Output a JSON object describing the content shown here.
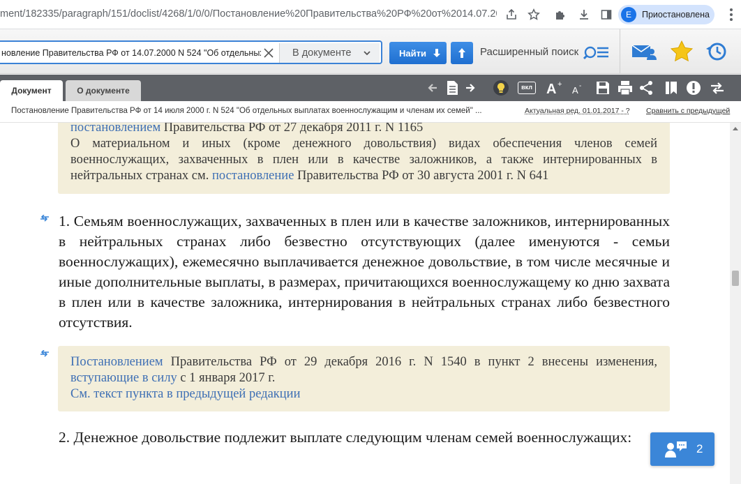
{
  "browser": {
    "url": "ment/182335/paragraph/151/doclist/4268/1/0/0/Постановление%20Правительства%20РФ%20от%2014.07.2000...",
    "profile_initial": "E",
    "profile_status": "Приостановлена"
  },
  "search": {
    "query": "новление Правительства РФ от 14.07.2000 N 524 \"Об отдельных вы",
    "scope": "В документе",
    "find_label": "Найти",
    "advanced_label": "Расширенный поиск"
  },
  "tabs": {
    "document": "Документ",
    "about": "О документе"
  },
  "doc_toolbar": {
    "toggle_label": "вкл"
  },
  "doc_line": {
    "title": "Постановление Правительства РФ от 14 июля 2000 г. N 524 \"Об отдельных выплатах военнослужащим и членам их семей\" ...",
    "edition": "Актуальная ред. 01.01.2017 - ?",
    "compare": "Сравнить с предыдущей"
  },
  "content": {
    "note1": {
      "link1": "постановлением",
      "text1": " Правительства РФ от 27 декабря 2011 г. N 1165",
      "text2": "О материальном и иных (кроме денежного довольствия) видах обеспечения членов семей военнослужащих, захваченных в плен или в качестве заложников, а также интернированных в нейтральных странах см. ",
      "link2": "постановление",
      "text3": " Правительства РФ от 30 августа 2001 г. N 641"
    },
    "para1": "1. Семьям военнослужащих, захваченных в плен или в качестве заложников, интернированных в нейтральных странах либо безвестно отсутствующих (далее именуются - семьи военнослужащих), ежемесячно выплачивается денежное довольствие, в том числе месячные и иные дополнительные выплаты, в размерах, причитающихся военнослужащему ко дню захвата в плен или в качестве заложника, интернирования в нейтральных странах либо безвестного отсутствия.",
    "note2": {
      "link1": "Постановлением",
      "text1": " Правительства РФ от 29 декабря 2016 г. N 1540 в пункт 2 внесены изменения, ",
      "link2": "вступающие в силу",
      "text2": " с 1 января 2017 г.",
      "link3": "См. текст пункта в предыдущей редакции"
    },
    "para2": "2. Денежное довольствие подлежит выплате следующим членам семей военнослужащих:"
  },
  "chat": {
    "count": "2"
  },
  "colors": {
    "accent": "#3b86d8",
    "note_bg": "#f3eeda",
    "link": "#3e6fb4",
    "toolbar_dark": "#5e6166"
  }
}
